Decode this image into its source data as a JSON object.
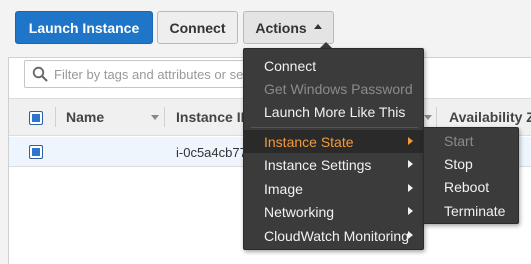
{
  "toolbar": {
    "launch_label": "Launch Instance",
    "connect_label": "Connect",
    "actions_label": "Actions"
  },
  "search": {
    "placeholder": "Filter by tags and attributes or se"
  },
  "table": {
    "columns": [
      "Name",
      "Instance ID",
      "Availability Z"
    ],
    "rows": [
      {
        "name": "",
        "instance_id": "i-0c5a4cb77"
      }
    ]
  },
  "actions_menu": {
    "items": [
      {
        "label": "Connect",
        "state": "enabled"
      },
      {
        "label": "Get Windows Password",
        "state": "disabled"
      },
      {
        "label": "Launch More Like This",
        "state": "enabled"
      },
      {
        "label": "Instance State",
        "state": "active",
        "submenu": true
      },
      {
        "label": "Instance Settings",
        "state": "enabled",
        "submenu": true
      },
      {
        "label": "Image",
        "state": "enabled",
        "submenu": true
      },
      {
        "label": "Networking",
        "state": "enabled",
        "submenu": true
      },
      {
        "label": "CloudWatch Monitoring",
        "state": "enabled",
        "submenu": true
      }
    ]
  },
  "instance_state_submenu": {
    "items": [
      {
        "label": "Start",
        "state": "disabled"
      },
      {
        "label": "Stop",
        "state": "enabled"
      },
      {
        "label": "Reboot",
        "state": "enabled"
      },
      {
        "label": "Terminate",
        "state": "enabled"
      }
    ]
  },
  "icons": {
    "search": "search-icon",
    "actions_caret": "caret-up-icon",
    "submenu_arrow": "chevron-right-icon",
    "sort": "sort-caret-icon"
  },
  "colors": {
    "primary_button": "#1f76c8",
    "menu_background": "#3b3b3b",
    "menu_active_text": "#f39a3a",
    "menu_disabled_text": "#8b8b8b",
    "selected_row": "#eef5fd"
  }
}
